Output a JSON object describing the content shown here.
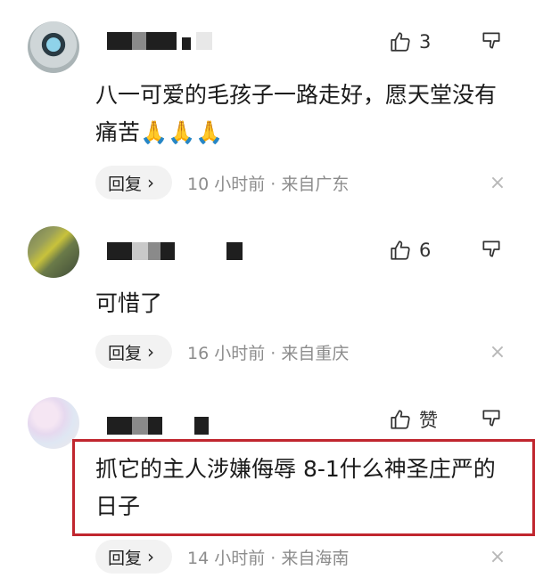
{
  "comments": [
    {
      "likes": "3",
      "text": "八一可爱的毛孩子一路走好，愿天堂没有痛苦🙏🙏🙏",
      "reply_label": "回复",
      "meta": "10 小时前 · 来自广东"
    },
    {
      "likes": "6",
      "text": "可惜了",
      "reply_label": "回复",
      "meta": "16 小时前 · 来自重庆"
    },
    {
      "likes": "赞",
      "text": "抓它的主人涉嫌侮辱 8-1什么神圣庄严的日子",
      "reply_label": "回复",
      "meta": "14 小时前 · 来自海南"
    }
  ],
  "icons": {
    "like": "thumbs-up-icon",
    "dislike": "thumbs-down-icon",
    "close": "close-icon",
    "chevron": "chevron-right-icon"
  },
  "colors": {
    "highlight_border": "#c0262e",
    "meta_text": "#8c8c8c",
    "pill_bg": "#f2f2f2"
  }
}
